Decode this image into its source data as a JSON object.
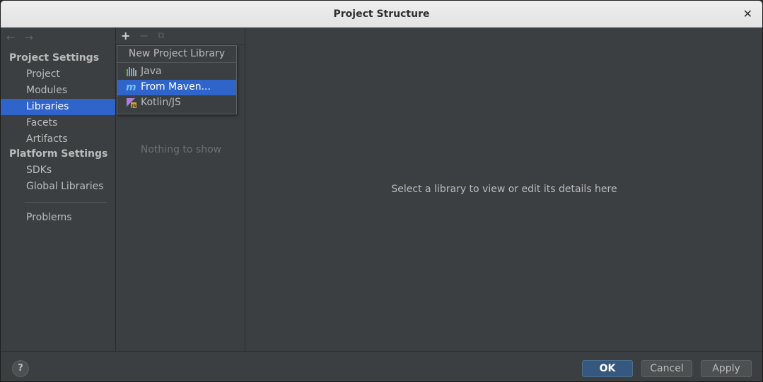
{
  "window": {
    "title": "Project Structure",
    "close_glyph": "✕"
  },
  "nav": {
    "back_glyph": "←",
    "forward_glyph": "→",
    "groups": {
      "project_settings": "Project Settings",
      "platform_settings": "Platform Settings"
    },
    "items": [
      {
        "label": "Project"
      },
      {
        "label": "Modules"
      },
      {
        "label": "Libraries",
        "selected": true
      },
      {
        "label": "Facets"
      },
      {
        "label": "Artifacts"
      },
      {
        "label": "SDKs"
      },
      {
        "label": "Global Libraries"
      },
      {
        "label": "Problems"
      }
    ]
  },
  "libraries_panel": {
    "toolbar": {
      "add_glyph": "+",
      "remove_glyph": "−",
      "copy_glyph": "⧉"
    },
    "empty_text": "Nothing to show"
  },
  "popup": {
    "title": "New Project Library",
    "items": [
      {
        "label": "Java",
        "icon": "java-library-icon"
      },
      {
        "label": "From Maven...",
        "icon": "maven-icon",
        "selected": true
      },
      {
        "label": "Kotlin/JS",
        "icon": "kotlin-js-icon"
      }
    ]
  },
  "detail": {
    "message": "Select a library to view or edit its details here"
  },
  "footer": {
    "help_glyph": "?",
    "ok_label": "OK",
    "cancel_label": "Cancel",
    "apply_label": "Apply"
  },
  "colors": {
    "selection": "#2f65ca",
    "panel": "#3c3f41",
    "ok_button": "#365880"
  }
}
